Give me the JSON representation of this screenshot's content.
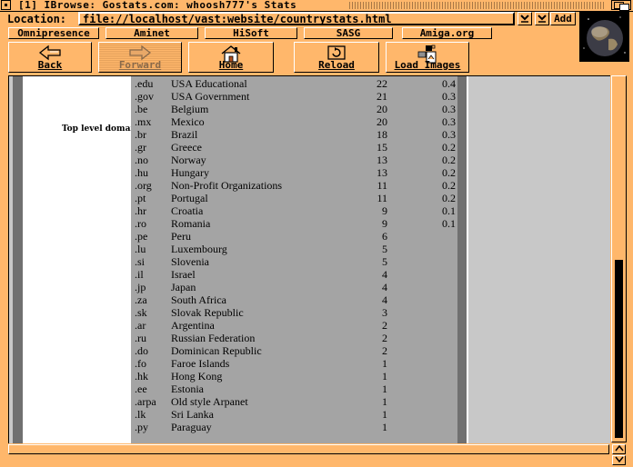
{
  "window": {
    "title": "[1] IBrowse: Gostats.com: whoosh777's Stats"
  },
  "location": {
    "label": "Location:",
    "url": "file://localhost/vast:website/countrystats.html",
    "add_label": "Add"
  },
  "hotlist": [
    "Omnipresence",
    "Aminet",
    "HiSoft",
    "SASG",
    "Amiga.org"
  ],
  "nav": {
    "back": "Back",
    "forward": "Forward",
    "home": "Home",
    "reload": "Reload",
    "load_images": "Load Images"
  },
  "table": {
    "row_label": "Top level domain",
    "rows": [
      {
        "code": ".edu",
        "name": "USA Educational",
        "count": "22",
        "pct": "0.4"
      },
      {
        "code": ".gov",
        "name": "USA Government",
        "count": "21",
        "pct": "0.3"
      },
      {
        "code": ".be",
        "name": "Belgium",
        "count": "20",
        "pct": "0.3"
      },
      {
        "code": ".mx",
        "name": "Mexico",
        "count": "20",
        "pct": "0.3"
      },
      {
        "code": ".br",
        "name": "Brazil",
        "count": "18",
        "pct": "0.3"
      },
      {
        "code": ".gr",
        "name": "Greece",
        "count": "15",
        "pct": "0.2"
      },
      {
        "code": ".no",
        "name": "Norway",
        "count": "13",
        "pct": "0.2"
      },
      {
        "code": ".hu",
        "name": "Hungary",
        "count": "13",
        "pct": "0.2"
      },
      {
        "code": ".org",
        "name": "Non-Profit Organizations",
        "count": "11",
        "pct": "0.2"
      },
      {
        "code": ".pt",
        "name": "Portugal",
        "count": "11",
        "pct": "0.2"
      },
      {
        "code": ".hr",
        "name": "Croatia",
        "count": "9",
        "pct": "0.1"
      },
      {
        "code": ".ro",
        "name": "Romania",
        "count": "9",
        "pct": "0.1"
      },
      {
        "code": ".pe",
        "name": "Peru",
        "count": "6",
        "pct": ""
      },
      {
        "code": ".lu",
        "name": "Luxembourg",
        "count": "5",
        "pct": ""
      },
      {
        "code": ".si",
        "name": "Slovenia",
        "count": "5",
        "pct": ""
      },
      {
        "code": ".il",
        "name": "Israel",
        "count": "4",
        "pct": ""
      },
      {
        "code": ".jp",
        "name": "Japan",
        "count": "4",
        "pct": ""
      },
      {
        "code": ".za",
        "name": "South Africa",
        "count": "4",
        "pct": ""
      },
      {
        "code": ".sk",
        "name": "Slovak Republic",
        "count": "3",
        "pct": ""
      },
      {
        "code": ".ar",
        "name": "Argentina",
        "count": "2",
        "pct": ""
      },
      {
        "code": ".ru",
        "name": "Russian Federation",
        "count": "2",
        "pct": ""
      },
      {
        "code": ".do",
        "name": "Dominican Republic",
        "count": "2",
        "pct": ""
      },
      {
        "code": ".fo",
        "name": "Faroe Islands",
        "count": "1",
        "pct": ""
      },
      {
        "code": ".hk",
        "name": "Hong Kong",
        "count": "1",
        "pct": ""
      },
      {
        "code": ".ee",
        "name": "Estonia",
        "count": "1",
        "pct": ""
      },
      {
        "code": ".arpa",
        "name": "Old style Arpanet",
        "count": "1",
        "pct": ""
      },
      {
        "code": ".lk",
        "name": "Sri Lanka",
        "count": "1",
        "pct": ""
      },
      {
        "code": ".py",
        "name": "Paraguay",
        "count": "1",
        "pct": ""
      }
    ]
  },
  "colors": {
    "chrome": "#ffb76b",
    "table_bg": "#a4a4a4",
    "page_bg": "#c8c8c8"
  }
}
